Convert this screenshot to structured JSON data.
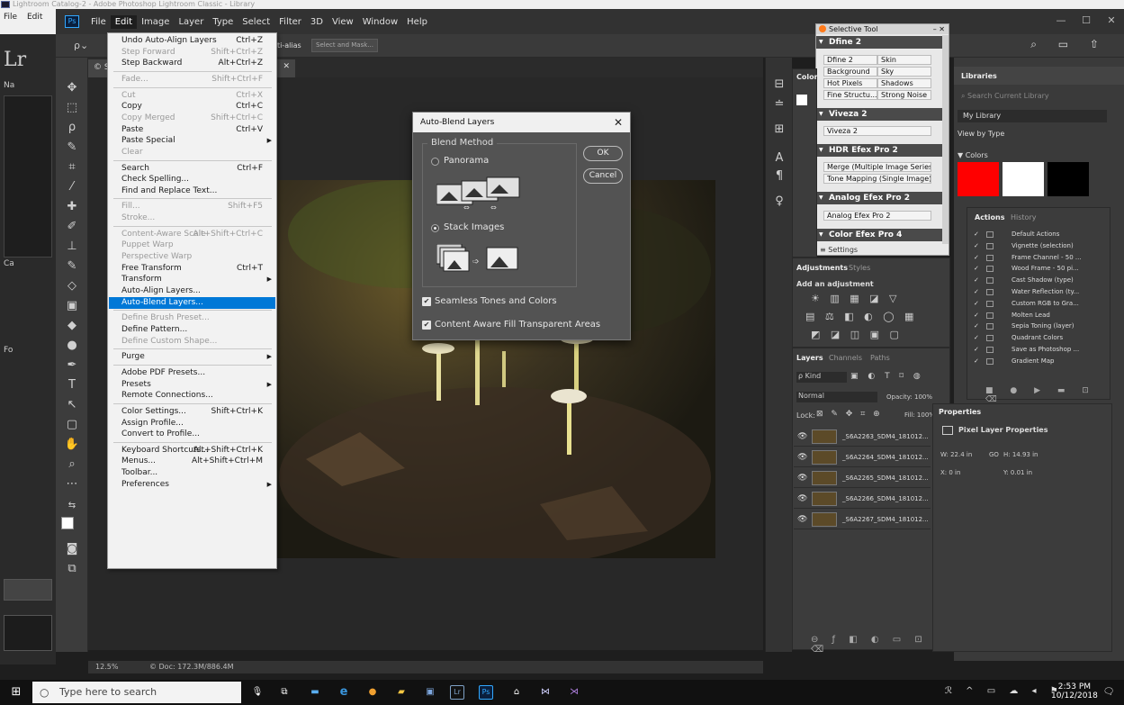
{
  "lightroom": {
    "title": "Lightroom Catalog-2 - Adobe Photoshop Lightroom Classic - Library",
    "menu": [
      "File",
      "Edit"
    ],
    "logo": "Lr",
    "left_labels": [
      "Na",
      "Ca",
      "Fo"
    ]
  },
  "photoshop": {
    "menubar": [
      "File",
      "Edit",
      "Image",
      "Layer",
      "Type",
      "Select",
      "Filter",
      "3D",
      "View",
      "Window",
      "Help"
    ],
    "active_menu": "Edit",
    "options_bar": {
      "antialias": "ti-alias",
      "select_mask": "Select and Mask..."
    },
    "doc_tab": "© S",
    "status": {
      "zoom": "12.5%",
      "doc": "© Doc: 172.3M/886.4M"
    }
  },
  "edit_menu": {
    "items": [
      {
        "label": "Undo Auto-Align Layers",
        "shortcut": "Ctrl+Z",
        "disabled": false
      },
      {
        "label": "Step Forward",
        "shortcut": "Shift+Ctrl+Z",
        "disabled": true
      },
      {
        "label": "Step Backward",
        "shortcut": "Alt+Ctrl+Z",
        "disabled": false
      },
      {
        "sep": true
      },
      {
        "label": "Fade...",
        "shortcut": "Shift+Ctrl+F",
        "disabled": true
      },
      {
        "sep": true
      },
      {
        "label": "Cut",
        "shortcut": "Ctrl+X",
        "disabled": true
      },
      {
        "label": "Copy",
        "shortcut": "Ctrl+C",
        "disabled": false
      },
      {
        "label": "Copy Merged",
        "shortcut": "Shift+Ctrl+C",
        "disabled": true
      },
      {
        "label": "Paste",
        "shortcut": "Ctrl+V",
        "disabled": false
      },
      {
        "label": "Paste Special",
        "shortcut": "",
        "submenu": true,
        "disabled": false
      },
      {
        "label": "Clear",
        "shortcut": "",
        "disabled": true
      },
      {
        "sep": true
      },
      {
        "label": "Search",
        "shortcut": "Ctrl+F",
        "disabled": false
      },
      {
        "label": "Check Spelling...",
        "shortcut": "",
        "disabled": false
      },
      {
        "label": "Find and Replace Text...",
        "shortcut": "",
        "disabled": false
      },
      {
        "sep": true
      },
      {
        "label": "Fill...",
        "shortcut": "Shift+F5",
        "disabled": true
      },
      {
        "label": "Stroke...",
        "shortcut": "",
        "disabled": true
      },
      {
        "sep": true
      },
      {
        "label": "Content-Aware Scale",
        "shortcut": "Alt+Shift+Ctrl+C",
        "disabled": true
      },
      {
        "label": "Puppet Warp",
        "shortcut": "",
        "disabled": true
      },
      {
        "label": "Perspective Warp",
        "shortcut": "",
        "disabled": true
      },
      {
        "label": "Free Transform",
        "shortcut": "Ctrl+T",
        "disabled": false
      },
      {
        "label": "Transform",
        "shortcut": "",
        "submenu": true,
        "disabled": false
      },
      {
        "label": "Auto-Align Layers...",
        "shortcut": "",
        "disabled": false
      },
      {
        "label": "Auto-Blend Layers...",
        "shortcut": "",
        "disabled": false,
        "selected": true
      },
      {
        "sep": true
      },
      {
        "label": "Define Brush Preset...",
        "shortcut": "",
        "disabled": true
      },
      {
        "label": "Define Pattern...",
        "shortcut": "",
        "disabled": false
      },
      {
        "label": "Define Custom Shape...",
        "shortcut": "",
        "disabled": true
      },
      {
        "sep": true
      },
      {
        "label": "Purge",
        "shortcut": "",
        "submenu": true,
        "disabled": false
      },
      {
        "sep": true
      },
      {
        "label": "Adobe PDF Presets...",
        "shortcut": "",
        "disabled": false
      },
      {
        "label": "Presets",
        "shortcut": "",
        "submenu": true,
        "disabled": false
      },
      {
        "label": "Remote Connections...",
        "shortcut": "",
        "disabled": false
      },
      {
        "sep": true
      },
      {
        "label": "Color Settings...",
        "shortcut": "Shift+Ctrl+K",
        "disabled": false
      },
      {
        "label": "Assign Profile...",
        "shortcut": "",
        "disabled": false
      },
      {
        "label": "Convert to Profile...",
        "shortcut": "",
        "disabled": false
      },
      {
        "sep": true
      },
      {
        "label": "Keyboard Shortcuts...",
        "shortcut": "Alt+Shift+Ctrl+K",
        "disabled": false
      },
      {
        "label": "Menus...",
        "shortcut": "Alt+Shift+Ctrl+M",
        "disabled": false
      },
      {
        "label": "Toolbar...",
        "shortcut": "",
        "disabled": false
      },
      {
        "label": "Preferences",
        "shortcut": "",
        "submenu": true,
        "disabled": false
      }
    ]
  },
  "dialog": {
    "title": "Auto-Blend Layers",
    "group_label": "Blend Method",
    "panorama": "Panorama",
    "stack": "Stack Images",
    "ok": "OK",
    "cancel": "Cancel",
    "seamless": "Seamless Tones and Colors",
    "content_aware": "Content Aware Fill Transparent Areas"
  },
  "selective_tool": {
    "title": "Selective Tool",
    "dfine": {
      "name": "Dfine 2",
      "cells": [
        "Dfine 2",
        "Skin",
        "Background",
        "Sky",
        "Hot Pixels",
        "Shadows",
        "Fine Structu...",
        "Strong Noise"
      ]
    },
    "viveza": {
      "name": "Viveza 2",
      "cells": [
        "Viveza 2"
      ]
    },
    "hdr": {
      "name": "HDR Efex Pro 2",
      "cells": [
        "Merge (Multiple Image Series)",
        "Tone Mapping (Single Image)"
      ]
    },
    "analog": {
      "name": "Analog Efex Pro 2",
      "cells": [
        "Analog Efex Pro 2"
      ]
    },
    "color": {
      "name": "Color Efex Pro 4"
    },
    "settings": "≡ Settings"
  },
  "panels": {
    "color_tab": "Color",
    "adjustments": {
      "tab": "Adjustments",
      "tab2": "Styles",
      "label": "Add an adjustment"
    },
    "layers": {
      "tabs": [
        "Layers",
        "Channels",
        "Paths"
      ],
      "kind": "ρ Kind",
      "blend": "Normal",
      "opacity": "Opacity: 100%",
      "lock": "Lock:",
      "fill": "Fill: 100%",
      "rows": [
        "_S6A2263_SDM4_181012...",
        "_S6A2264_SDM4_181012...",
        "_S6A2265_SDM4_181012...",
        "_S6A2266_SDM4_181012...",
        "_S6A2267_SDM4_181012..."
      ]
    },
    "libraries": {
      "title": "Libraries",
      "search": "Search Current Library",
      "library": "My Library",
      "view": "View by Type",
      "colors": "▼ Colors",
      "swatches": [
        "#ff0000",
        "#ffffff",
        "#000000"
      ]
    },
    "actions": {
      "tabs": [
        "Actions",
        "History"
      ],
      "items": [
        "Default Actions",
        "Vignette (selection)",
        "Frame Channel - 50 ...",
        "Wood Frame - 50 pi...",
        "Cast Shadow (type)",
        "Water Reflection (ty...",
        "Custom RGB to Gra...",
        "Molten Lead",
        "Sepia Toning (layer)",
        "Quadrant Colors",
        "Save as Photoshop ...",
        "Gradient Map"
      ]
    },
    "properties": {
      "title": "Properties",
      "subtitle": "Pixel Layer Properties",
      "w": "W:  22.4 in",
      "h": "H:  14.93 in",
      "x": "X:  0 in",
      "y": "Y:  0.01 in",
      "link": "GO"
    }
  },
  "taskbar": {
    "search": "Type here to search",
    "time": "2:53 PM",
    "date": "10/12/2018"
  }
}
